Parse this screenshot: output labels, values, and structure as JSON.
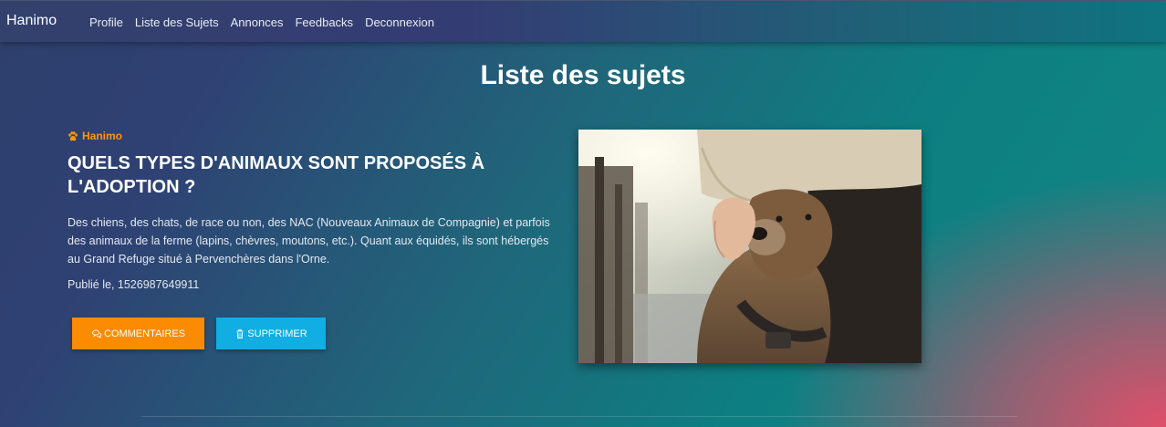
{
  "navbar": {
    "brand": "Hanimo",
    "links": [
      "Profile",
      "Liste des Sujets",
      "Annonces",
      "Feedbacks",
      "Deconnexion"
    ]
  },
  "page": {
    "title": "Liste des sujets"
  },
  "topic": {
    "tag": "Hanimo",
    "title": "QUELS TYPES D'ANIMAUX SONT PROPOSÉS À L'ADOPTION ?",
    "description": "Des chiens, des chats, de race ou non, des NAC (Nouveaux Animaux de Compagnie) et parfois des animaux de la ferme (lapins, chèvres, moutons, etc.). Quant aux équidés, ils sont hébergés au Grand Refuge situé à Pervenchères dans l'Orne.",
    "published": "Publié le, 1526987649911",
    "comments_label": "COMMENTAIRES",
    "delete_label": "SUPPRIMER",
    "image_alt": "dog-photo"
  },
  "colors": {
    "accent_orange": "#fb8b00",
    "accent_blue": "#10aee3",
    "tag_orange": "#ff9800"
  }
}
